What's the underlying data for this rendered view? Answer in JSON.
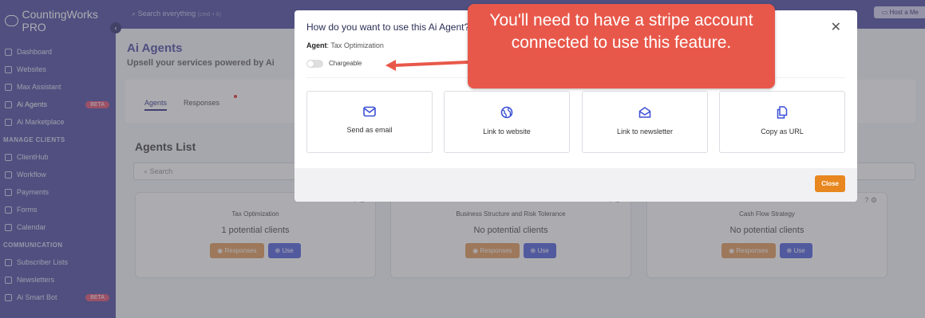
{
  "app": {
    "name": "CountingWorks PRO"
  },
  "topbar": {
    "search_placeholder": "Search everything",
    "search_hint": "(cmd + k)",
    "host_button": "Host a Me"
  },
  "sidebar": {
    "items": [
      {
        "label": "Dashboard"
      },
      {
        "label": "Websites"
      },
      {
        "label": "Max Assistant"
      },
      {
        "label": "Ai Agents",
        "badge": "BETA"
      },
      {
        "label": "Ai Marketplace"
      }
    ],
    "section_clients": "MANAGE CLIENTS",
    "client_items": [
      {
        "label": "ClientHub"
      },
      {
        "label": "Workflow"
      },
      {
        "label": "Payments"
      },
      {
        "label": "Forms"
      },
      {
        "label": "Calendar"
      }
    ],
    "section_comm": "COMMUNICATION",
    "comm_items": [
      {
        "label": "Subscriber Lists"
      },
      {
        "label": "Newsletters"
      },
      {
        "label": "Ai Smart Bot",
        "badge": "BETA"
      }
    ]
  },
  "main": {
    "title": "Ai Agents",
    "subtitle": "Upsell your services powered by Ai",
    "tabs": [
      {
        "label": "Agents"
      },
      {
        "label": "Responses"
      }
    ],
    "list_title": "Agents List",
    "search_placeholder": "Search",
    "agents": [
      {
        "name": "Tax Optimization",
        "potential": "1 potential clients",
        "responses": "Responses",
        "use": "Use"
      },
      {
        "name": "Business Structure and Risk Tolerance",
        "potential": "No potential clients",
        "responses": "Responses",
        "use": "Use"
      },
      {
        "name": "Cash Flow Strategy",
        "potential": "No potential clients",
        "responses": "Responses",
        "use": "Use"
      }
    ]
  },
  "modal": {
    "title": "How do you want to use this Ai Agent?",
    "agent_label": "Agent",
    "agent_value": "Tax Optimization",
    "toggle_label": "Chargeable",
    "options": [
      {
        "label": "Send as email",
        "icon": "envelope-icon"
      },
      {
        "label": "Link to website",
        "icon": "globe-icon"
      },
      {
        "label": "Link to newsletter",
        "icon": "open-envelope-icon"
      },
      {
        "label": "Copy as URL",
        "icon": "copy-icon"
      }
    ],
    "close_label": "Close"
  },
  "callout": {
    "text": "You'll need to have a stripe account connected to use this feature."
  },
  "colors": {
    "sidebar": "#5856a8",
    "callout": "#e8584a",
    "close_button": "#e8871f",
    "use_button": "#5c6be0",
    "responses_button": "#e3a064"
  }
}
